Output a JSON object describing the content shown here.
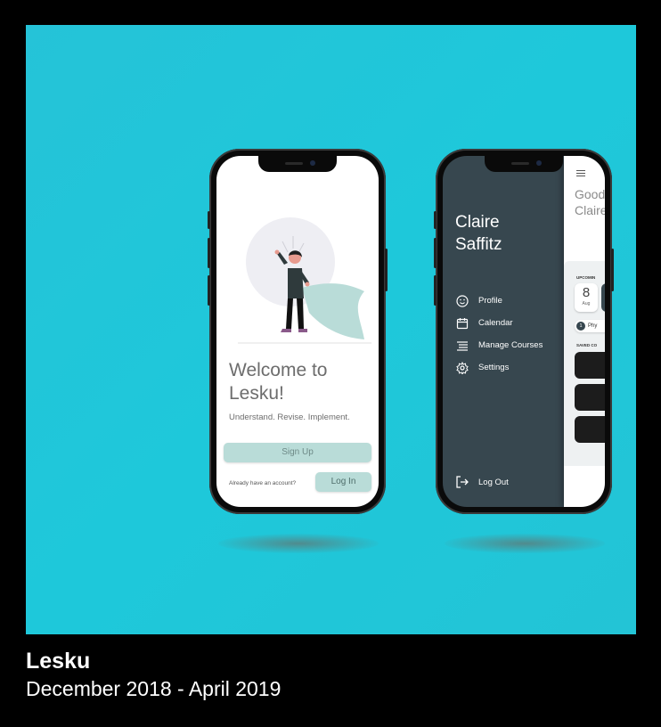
{
  "phone_welcome": {
    "heading": "Welcome to Lesku!",
    "tagline": "Understand. Revise. Implement.",
    "signup_label": "Sign Up",
    "account_prompt": "Already have an account?",
    "login_label": "Log In"
  },
  "phone_menu": {
    "user_name": "Claire Saffitz",
    "menu_items": [
      {
        "label": "Profile",
        "icon": "smile-icon"
      },
      {
        "label": "Calendar",
        "icon": "calendar-icon"
      },
      {
        "label": "Manage Courses",
        "icon": "list-icon"
      },
      {
        "label": "Settings",
        "icon": "gear-icon"
      }
    ],
    "logout_label": "Log Out",
    "panel": {
      "greeting": "Good\nClaire",
      "upcoming_label": "UPCOMIN",
      "date_day": "8",
      "date_month": "Aug",
      "course_number": "1",
      "course_name": "Phy",
      "saved_label": "SAVED CO"
    }
  },
  "caption": {
    "title": "Lesku",
    "dates": "December 2018 - April 2019"
  },
  "colors": {
    "background": "#1ec8da",
    "sidebar": "#37474f",
    "button": "#b9dcd8"
  }
}
